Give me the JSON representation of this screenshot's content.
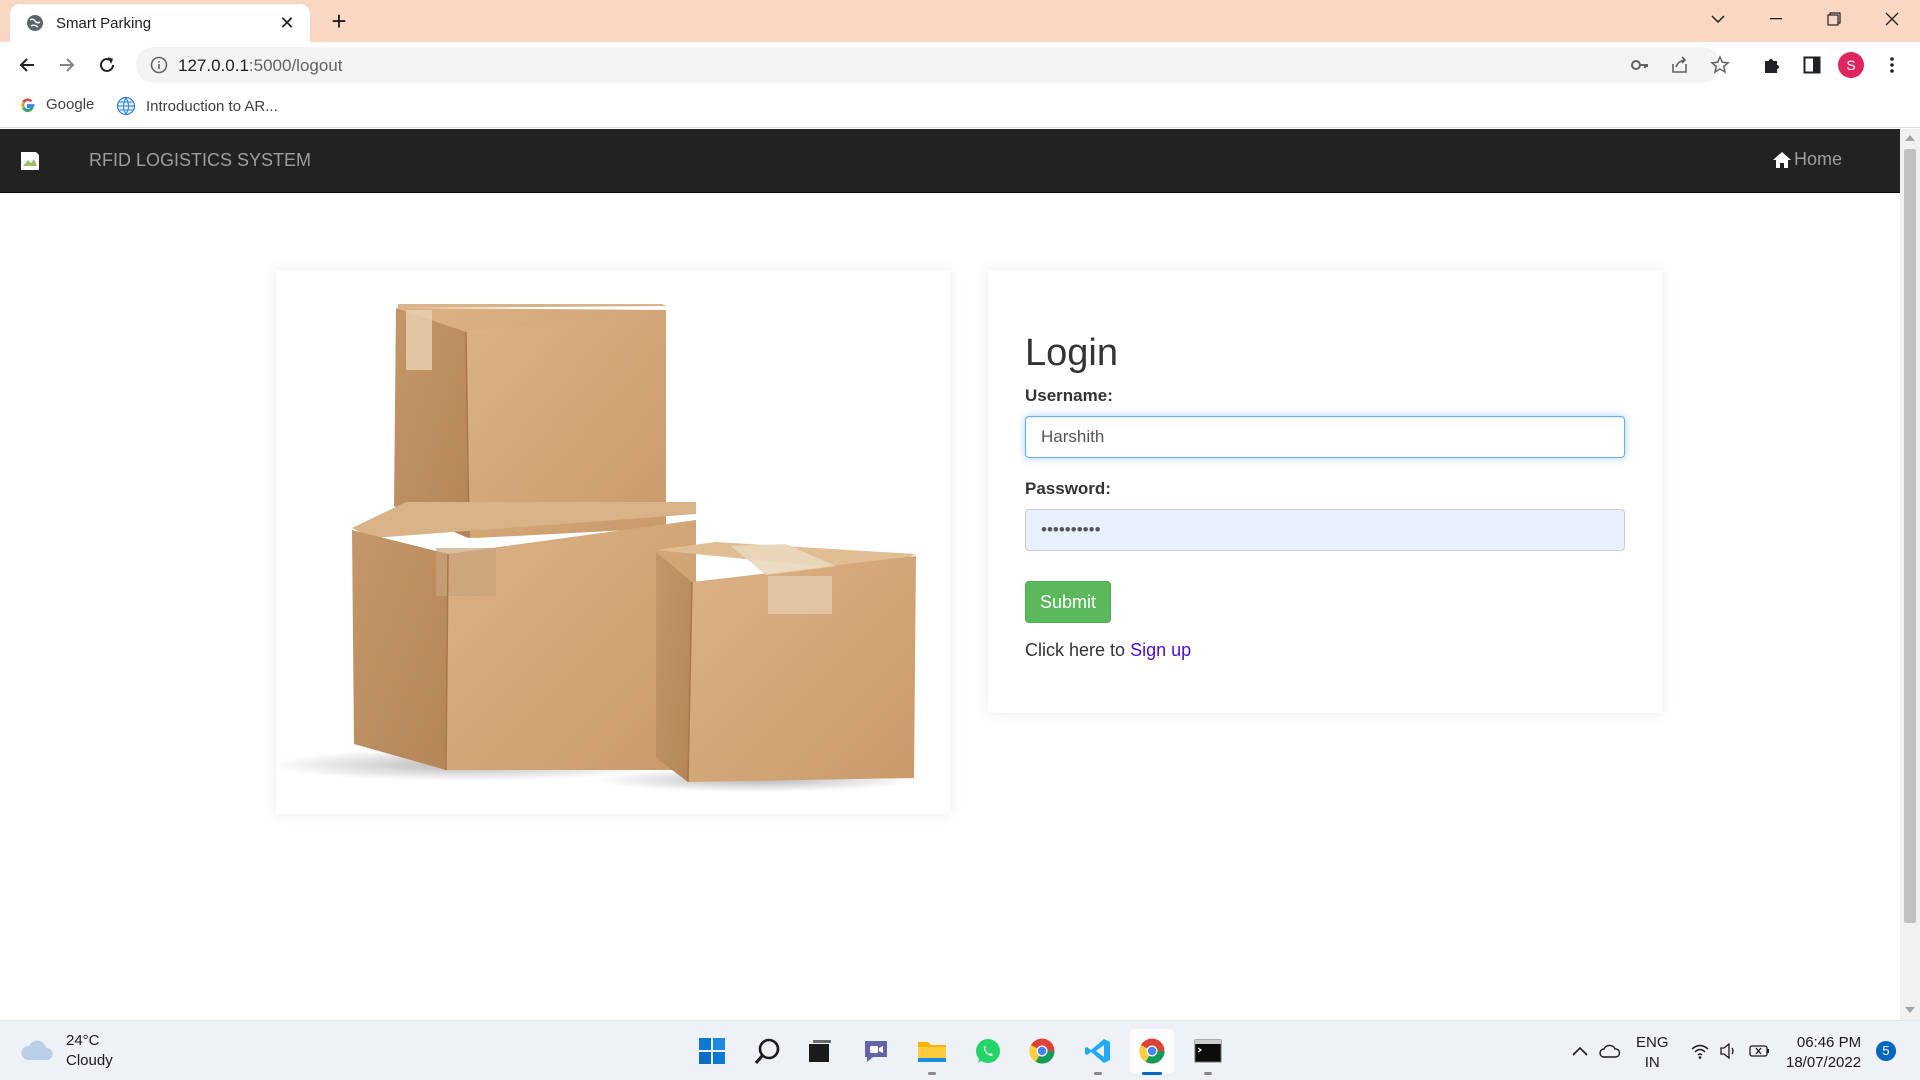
{
  "browser": {
    "tab_title": "Smart Parking",
    "url_host": "127.0.0.1",
    "url_rest": ":5000/logout",
    "bookmarks": [
      {
        "label": "Google"
      },
      {
        "label": "Introduction to AR..."
      }
    ],
    "profile_initial": "S"
  },
  "navbar": {
    "brand": "RFID LOGISTICS SYSTEM",
    "home_label": "Home"
  },
  "login": {
    "title": "Login",
    "username_label": "Username:",
    "username_value": "Harshith",
    "password_label": "Password:",
    "password_value": "••••••••••",
    "submit_label": "Submit",
    "signup_prefix": "Click here to",
    "signup_link": "Sign up"
  },
  "taskbar": {
    "temperature": "24°C",
    "weather": "Cloudy",
    "lang_top": "ENG",
    "lang_bottom": "IN",
    "time": "06:46 PM",
    "date": "18/07/2022",
    "notification_count": "5"
  },
  "colors": {
    "tabbar": "#fad7c3",
    "navbar": "#222222",
    "submit": "#5cb85c",
    "link": "#4b0fd4",
    "autofill": "#e8f0fe"
  }
}
